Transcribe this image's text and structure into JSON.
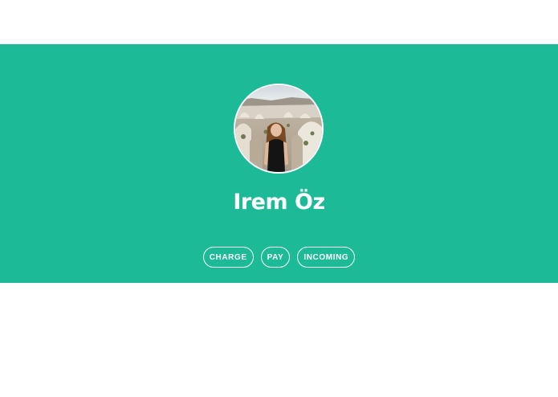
{
  "profile": {
    "name": "Irem Öz",
    "avatar_alt": "Profile photo"
  },
  "actions": {
    "charge_label": "CHARGE",
    "pay_label": "PAY",
    "incoming_label": "INCOMING"
  },
  "colors": {
    "hero_background": "#1dba98",
    "page_background": "#ffffff",
    "text": "#ffffff"
  }
}
